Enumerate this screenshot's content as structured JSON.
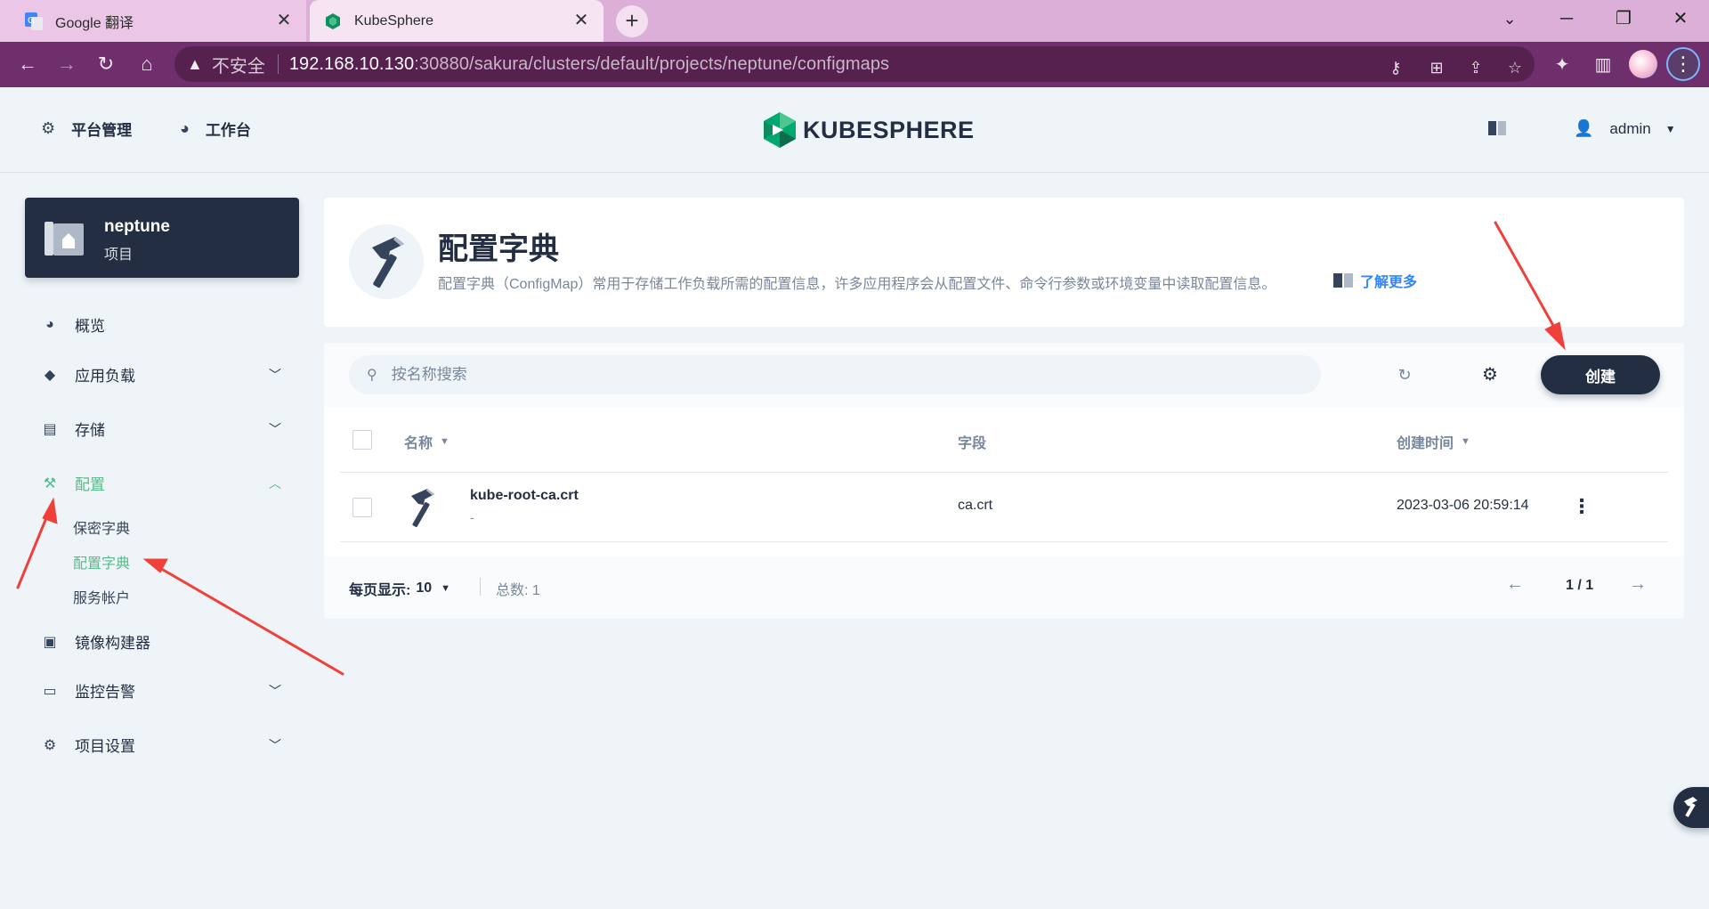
{
  "browser": {
    "tabs": [
      {
        "title": "Google 翻译",
        "close": "✕"
      },
      {
        "title": "KubeSphere",
        "close": "✕"
      }
    ],
    "new_tab": "+",
    "window_controls": {
      "minimize": "─",
      "maximize": "❐",
      "close": "✕",
      "tab_search": "⌄"
    },
    "address": {
      "security_label": "不安全",
      "host": "192.168.10.130",
      "rest": ":30880/sakura/clusters/default/projects/neptune/configmaps"
    },
    "icons": [
      "back-icon",
      "forward-icon",
      "reload-icon",
      "home-icon",
      "key-icon",
      "translate-icon",
      "share-icon",
      "star-icon",
      "extensions-icon",
      "sidepanel-icon",
      "menu-icon"
    ]
  },
  "header": {
    "platform_label": "平台管理",
    "workbench_label": "工作台",
    "logo_text": "KUBESPHERE",
    "user_name": "admin"
  },
  "project": {
    "name": "neptune",
    "type": "项目"
  },
  "sidebar": {
    "items": [
      {
        "label": "概览"
      },
      {
        "label": "应用负载"
      },
      {
        "label": "存储"
      },
      {
        "label": "配置"
      },
      {
        "label": "镜像构建器"
      },
      {
        "label": "监控告警"
      },
      {
        "label": "项目设置"
      }
    ],
    "config_subitems": [
      {
        "label": "保密字典"
      },
      {
        "label": "配置字典"
      },
      {
        "label": "服务帐户"
      }
    ],
    "active_item": "配置",
    "active_subitem": "配置字典"
  },
  "banner": {
    "title": "配置字典",
    "description": "配置字典（ConfigMap）常用于存储工作负载所需的配置信息，许多应用程序会从配置文件、命令行参数或环境变量中读取配置信息。",
    "learn_more": "了解更多"
  },
  "toolbar": {
    "search_placeholder": "按名称搜索",
    "create_label": "创建"
  },
  "table": {
    "columns": [
      "名称",
      "字段",
      "创建时间"
    ],
    "rows": [
      {
        "name": "kube-root-ca.crt",
        "description": "-",
        "field": "ca.crt",
        "created": "2023-03-06 20:59:14"
      }
    ]
  },
  "pagination": {
    "per_page_label": "每页显示:",
    "per_page_value": "10",
    "total_label": "总数:",
    "total_value": "1",
    "page": "1 / 1"
  },
  "colors": {
    "accent": "#55bc8a",
    "dark": "#242e42",
    "annotation": "#f0403a",
    "link": "#3385ff"
  }
}
